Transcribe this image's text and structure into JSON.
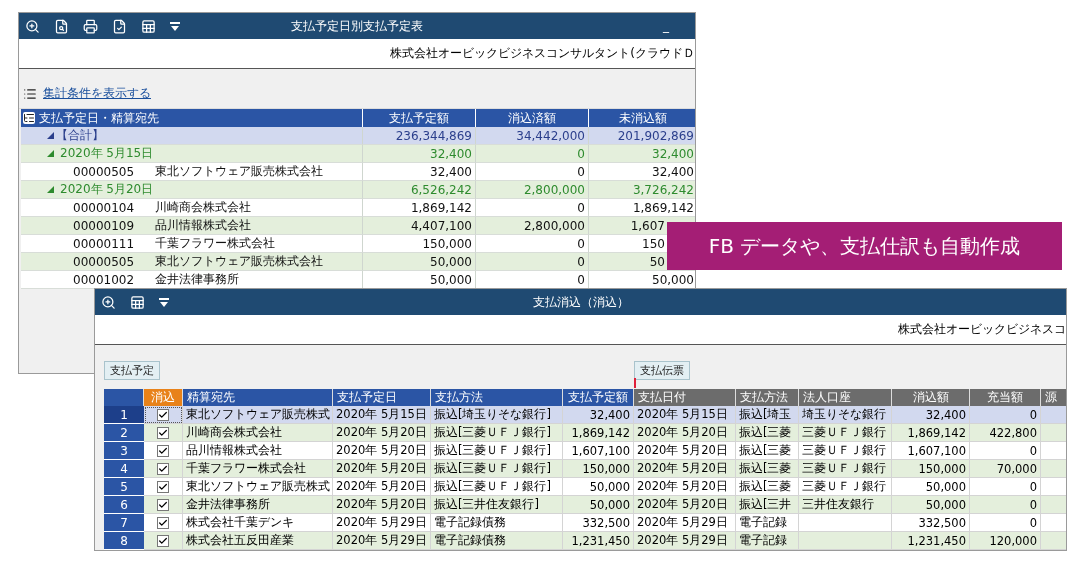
{
  "report_window": {
    "title": "支払予定日別支払予定表",
    "minimize": "_",
    "company": "株式会社オービックビジネスコンサルタント(クラウドＤ",
    "summary_link": "集計条件を表示する",
    "table": {
      "columns": [
        "支払予定日・精算宛先",
        "支払予定額",
        "消込済額",
        "未消込額"
      ],
      "rows": [
        {
          "kind": "total",
          "expanded": true,
          "label": "【合計】",
          "values": [
            "236,344,869",
            "34,442,000",
            "201,902,869"
          ]
        },
        {
          "kind": "group",
          "expanded": true,
          "label": "2020年  5月15日",
          "values": [
            "32,400",
            "0",
            "32,400"
          ]
        },
        {
          "kind": "detail",
          "code": "00000505",
          "name": "東北ソフトウェア販売株式会社",
          "values": [
            "32,400",
            "0",
            "32,400"
          ]
        },
        {
          "kind": "group",
          "expanded": true,
          "label": "2020年  5月20日",
          "values": [
            "6,526,242",
            "2,800,000",
            "3,726,242"
          ]
        },
        {
          "kind": "detail",
          "code": "00000104",
          "name": "川崎商会株式会社",
          "values": [
            "1,869,142",
            "0",
            "1,869,142"
          ]
        },
        {
          "kind": "detail",
          "code": "00000109",
          "name": "品川情報株式会社",
          "values": [
            "4,407,100",
            "2,800,000",
            "1,607"
          ]
        },
        {
          "kind": "detail",
          "code": "00000111",
          "name": "千葉フラワー株式会社",
          "values": [
            "150,000",
            "0",
            "150"
          ]
        },
        {
          "kind": "detail",
          "code": "00000505",
          "name": "東北ソフトウェア販売株式会社",
          "values": [
            "50,000",
            "0",
            "50"
          ]
        },
        {
          "kind": "detail",
          "code": "00001002",
          "name": "金井法律事務所",
          "values": [
            "50,000",
            "0",
            "50,000"
          ]
        }
      ]
    }
  },
  "callout": "FB データや、支払仕訳も自動作成",
  "reconcile_window": {
    "title": "支払消込（消込）",
    "company": "株式会社オービックビジネスコ",
    "buttons": [
      {
        "label": "支払予定"
      },
      {
        "label": "支払伝票"
      }
    ],
    "table": {
      "check_column": "消込",
      "columns": [
        {
          "kind": "main",
          "label": "精算宛先"
        },
        {
          "kind": "main",
          "label": "支払予定日"
        },
        {
          "kind": "main",
          "label": "支払方法"
        },
        {
          "kind": "main",
          "label": "支払予定額"
        },
        {
          "kind": "sub",
          "label": "支払日付"
        },
        {
          "kind": "sub",
          "label": "支払方法"
        },
        {
          "kind": "sub",
          "label": "法人口座"
        },
        {
          "kind": "sub",
          "label": "消込額"
        },
        {
          "kind": "sub",
          "label": "充当額"
        },
        {
          "kind": "sub",
          "label": "源"
        }
      ],
      "rows": [
        {
          "number": "1",
          "checked": true,
          "selected": true,
          "cells": [
            "東北ソフトウェア販売株式",
            "2020年  5月15日",
            "振込[埼玉りそな銀行]",
            "32,400",
            "2020年  5月15日",
            "振込[埼玉",
            "埼玉りそな銀行",
            "32,400",
            "0"
          ]
        },
        {
          "number": "2",
          "checked": true,
          "selected": false,
          "cells": [
            "川崎商会株式会社",
            "2020年  5月20日",
            "振込[三菱ＵＦＪ銀行]",
            "1,869,142",
            "2020年  5月20日",
            "振込[三菱",
            "三菱ＵＦＪ銀行",
            "1,869,142",
            "422,800"
          ]
        },
        {
          "number": "3",
          "checked": true,
          "selected": false,
          "cells": [
            "品川情報株式会社",
            "2020年  5月20日",
            "振込[三菱ＵＦＪ銀行]",
            "1,607,100",
            "2020年  5月20日",
            "振込[三菱",
            "三菱ＵＦＪ銀行",
            "1,607,100",
            "0"
          ]
        },
        {
          "number": "4",
          "checked": true,
          "selected": false,
          "cells": [
            "千葉フラワー株式会社",
            "2020年  5月20日",
            "振込[三菱ＵＦＪ銀行]",
            "150,000",
            "2020年  5月20日",
            "振込[三菱",
            "三菱ＵＦＪ銀行",
            "150,000",
            "70,000"
          ]
        },
        {
          "number": "5",
          "checked": true,
          "selected": false,
          "cells": [
            "東北ソフトウェア販売株式",
            "2020年  5月20日",
            "振込[三菱ＵＦＪ銀行]",
            "50,000",
            "2020年  5月20日",
            "振込[三菱",
            "三菱ＵＦＪ銀行",
            "50,000",
            "0"
          ]
        },
        {
          "number": "6",
          "checked": true,
          "selected": false,
          "cells": [
            "金井法律事務所",
            "2020年  5月20日",
            "振込[三井住友銀行]",
            "50,000",
            "2020年  5月20日",
            "振込[三井",
            "三井住友銀行",
            "50,000",
            "0"
          ]
        },
        {
          "number": "7",
          "checked": true,
          "selected": false,
          "cells": [
            "株式会社千葉デンキ",
            "2020年  5月29日",
            "電子記録債務",
            "332,500",
            "2020年  5月29日",
            "電子記録",
            null,
            "332,500",
            "0"
          ]
        },
        {
          "number": "8",
          "checked": true,
          "selected": false,
          "cells": [
            "株式会社五反田産業",
            "2020年  5月29日",
            "電子記録債務",
            "1,231,450",
            "2020年  5月29日",
            "電子記録",
            null,
            "1,231,450",
            "120,000"
          ]
        }
      ]
    }
  }
}
